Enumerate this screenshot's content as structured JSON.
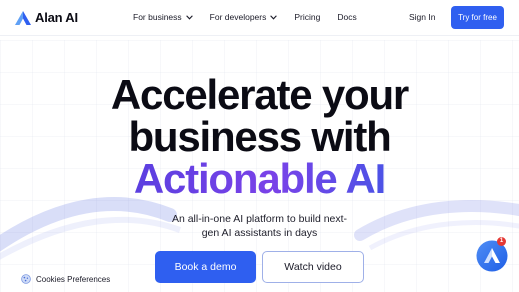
{
  "brand": {
    "name": "Alan AI",
    "logo_icon": "alan-logo-icon",
    "accent_color": "#2f5ff0",
    "gradient_colors": [
      "#5b3fe0",
      "#7a42e8",
      "#4c52e6"
    ]
  },
  "nav": {
    "items": [
      {
        "label": "For business",
        "icon": "chevron-down-icon"
      },
      {
        "label": "For developers",
        "icon": "chevron-down-icon"
      },
      {
        "label": "Pricing"
      },
      {
        "label": "Docs"
      }
    ],
    "sign_in": "Sign In",
    "try_free": "Try for free"
  },
  "hero": {
    "title_line1": "Accelerate your",
    "title_line2": "business with",
    "title_line3": "Actionable AI",
    "subtitle_line1": "An all-in-one AI platform to build next-",
    "subtitle_line2": "gen AI assistants in days",
    "primary_cta": "Book a demo",
    "secondary_cta": "Watch video"
  },
  "cookies": {
    "label": "Cookies Preferences",
    "icon": "cookie-icon"
  },
  "assistant": {
    "icon": "alan-assistant-icon",
    "badge": "1",
    "badge_color": "#e53935"
  }
}
